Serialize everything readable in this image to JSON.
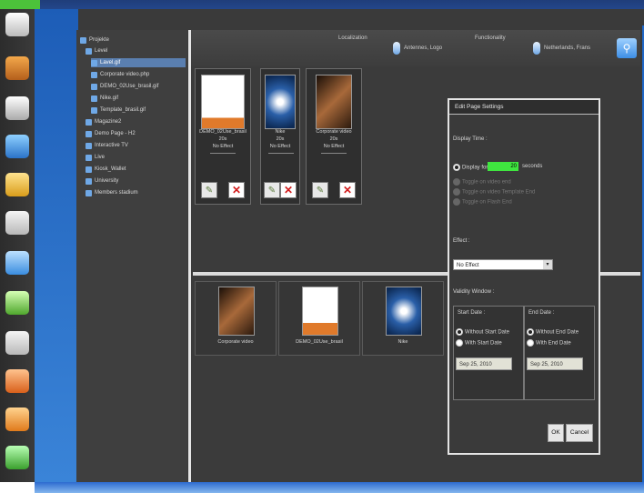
{
  "toolbar": {
    "localization_label": "Localization",
    "localization_value": "Antennes, Logo",
    "functionality_label": "Functionality",
    "functionality_value": "Netherlands, Frans"
  },
  "tree": {
    "items": [
      {
        "label": "Projekte",
        "level": 0
      },
      {
        "label": "Level",
        "level": 1
      },
      {
        "label": "Lavel.gif",
        "level": 2,
        "selected": true
      },
      {
        "label": "Corporate video.php",
        "level": 2
      },
      {
        "label": "DEMO_02Use_brasil.gif",
        "level": 2
      },
      {
        "label": "Nike.gif",
        "level": 2
      },
      {
        "label": "Template_brasil.gif",
        "level": 2
      },
      {
        "label": "Magazine2",
        "level": 1
      },
      {
        "label": "Demo Page - H2",
        "level": 1
      },
      {
        "label": "Interactive TV",
        "level": 1
      },
      {
        "label": "Live",
        "level": 1
      },
      {
        "label": "Kiosk_Wallet",
        "level": 1
      },
      {
        "label": "University",
        "level": 1
      },
      {
        "label": "Members stadium",
        "level": 1
      }
    ]
  },
  "page_tiles": [
    {
      "name": "DEMO_02Use_brasil",
      "duration": "20s",
      "effect": "No Effect",
      "thumb": "doc"
    },
    {
      "name": "Nike",
      "duration": "20s",
      "effect": "No Effect",
      "thumb": "blue"
    },
    {
      "name": "Corporate video",
      "duration": "20s",
      "effect": "No Effect",
      "thumb": "photo"
    }
  ],
  "playlist": [
    {
      "label": "Corporate video",
      "thumb": "photo"
    },
    {
      "label": "DEMO_02Use_brasil",
      "thumb": "doc"
    },
    {
      "label": "Nike",
      "thumb": "blue"
    }
  ],
  "dialog": {
    "title": "Edit Page Settings",
    "display_time_label": "Display Time :",
    "display_for_label": "Display for",
    "seconds_value": "20",
    "seconds_label": "seconds",
    "option_2": "Toggle on video end",
    "option_3": "Toggle on video Template End",
    "option_4": "Toggle on Flash End",
    "effect_label": "Effect :",
    "effect_value": "No Effect",
    "validity_label": "Validity Window :",
    "start_date_label": "Start Date :",
    "end_date_label": "End Date :",
    "without_start": "Without Start Date",
    "with_start": "With Start Date",
    "without_end": "Without End Date",
    "with_end": "With End Date",
    "start_date_value": "Sep 25, 2010",
    "end_date_value": "Sep 25, 2010",
    "ok_label": "OK",
    "cancel_label": "Cancel"
  },
  "colors": {
    "green_input": "#3fe63f",
    "delete_red": "#d21d1d",
    "accent_blue": "#1f67c8"
  }
}
